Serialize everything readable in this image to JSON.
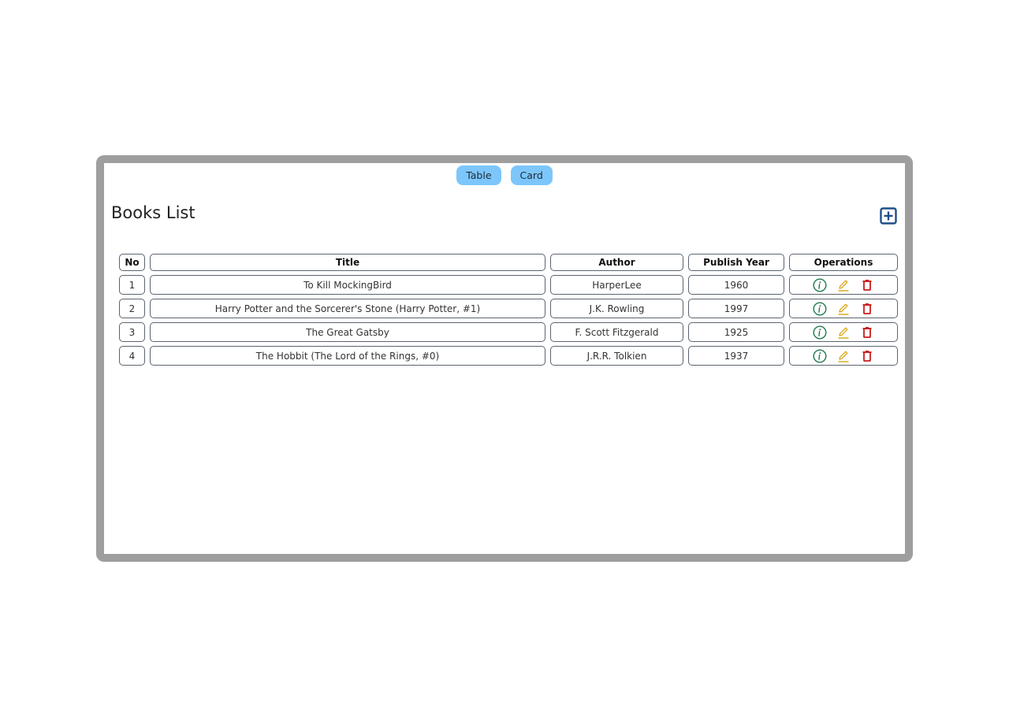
{
  "view_toggle": {
    "table_label": "Table",
    "card_label": "Card"
  },
  "page": {
    "title": "Books List"
  },
  "colors": {
    "toggle_bg": "#7cc6fb",
    "add_icon": "#1e4f8a",
    "info_icon": "#1f7a4d",
    "edit_icon": "#d9a514",
    "delete_icon": "#c81e1e",
    "frame_border": "#9e9e9e"
  },
  "icons": {
    "add": "plus-square-icon",
    "info": "info-circle-icon",
    "edit": "pencil-icon",
    "delete": "trash-icon"
  },
  "table": {
    "headers": {
      "no": "No",
      "title": "Title",
      "author": "Author",
      "publish_year": "Publish Year",
      "operations": "Operations"
    },
    "rows": [
      {
        "no": "1",
        "title": "To Kill MockingBird",
        "author": "HarperLee",
        "publish_year": "1960"
      },
      {
        "no": "2",
        "title": "Harry Potter and the Sorcerer's Stone (Harry Potter, #1)",
        "author": "J.K. Rowling",
        "publish_year": "1997"
      },
      {
        "no": "3",
        "title": "The Great Gatsby",
        "author": "F. Scott Fitzgerald",
        "publish_year": "1925"
      },
      {
        "no": "4",
        "title": "The Hobbit (The Lord of the Rings, #0)",
        "author": "J.R.R. Tolkien",
        "publish_year": "1937"
      }
    ]
  }
}
